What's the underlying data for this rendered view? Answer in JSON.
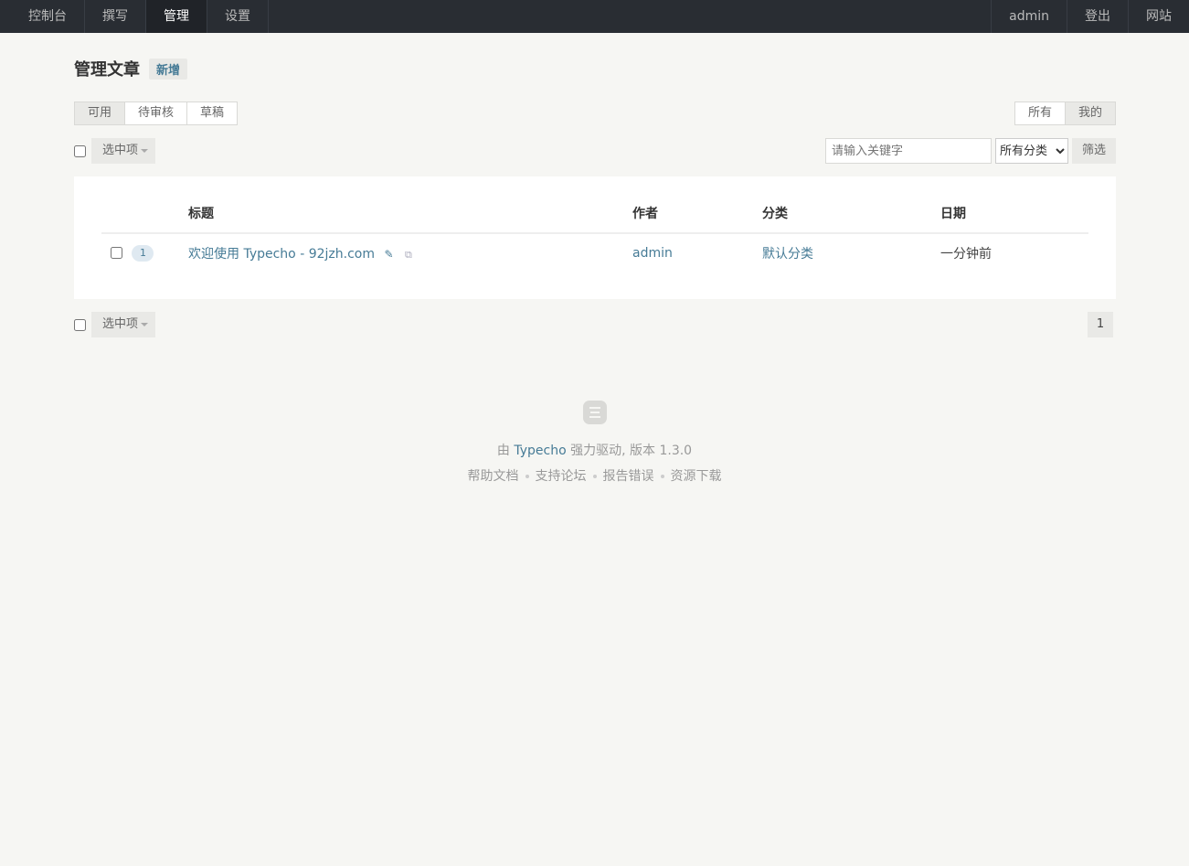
{
  "nav": {
    "left": [
      {
        "label": "控制台",
        "name": "nav-dashboard"
      },
      {
        "label": "撰写",
        "name": "nav-write"
      },
      {
        "label": "管理",
        "name": "nav-manage"
      },
      {
        "label": "设置",
        "name": "nav-settings"
      }
    ],
    "active": "管理",
    "right": [
      {
        "label": "admin",
        "name": "nav-user"
      },
      {
        "label": "登出",
        "name": "nav-logout"
      },
      {
        "label": "网站",
        "name": "nav-site"
      }
    ]
  },
  "page": {
    "title": "管理文章",
    "add_new": "新增"
  },
  "status_tabs": [
    "可用",
    "待审核",
    "草稿"
  ],
  "owner_tabs": [
    "所有",
    "我的"
  ],
  "ops": {
    "selected_label": "选中项",
    "search_placeholder": "请输入关键字",
    "category_selected": "所有分类",
    "filter_label": "筛选"
  },
  "table": {
    "headers": {
      "title": "标题",
      "author": "作者",
      "category": "分类",
      "date": "日期"
    },
    "rows": [
      {
        "comments": "1",
        "title": "欢迎使用 Typecho - 92jzh.com",
        "author": "admin",
        "category": "默认分类",
        "date": "一分钟前"
      }
    ]
  },
  "pagination": {
    "current": "1"
  },
  "footer": {
    "powered_prefix": "由",
    "powered_brand": "Typecho",
    "powered_suffix": "强力驱动, 版本 1.3.0",
    "links": [
      "帮助文档",
      "支持论坛",
      "报告错误",
      "资源下载"
    ]
  },
  "colors": {
    "nav_bg": "#292d33",
    "link": "#467b96",
    "page_bg": "#f6f6f3"
  }
}
